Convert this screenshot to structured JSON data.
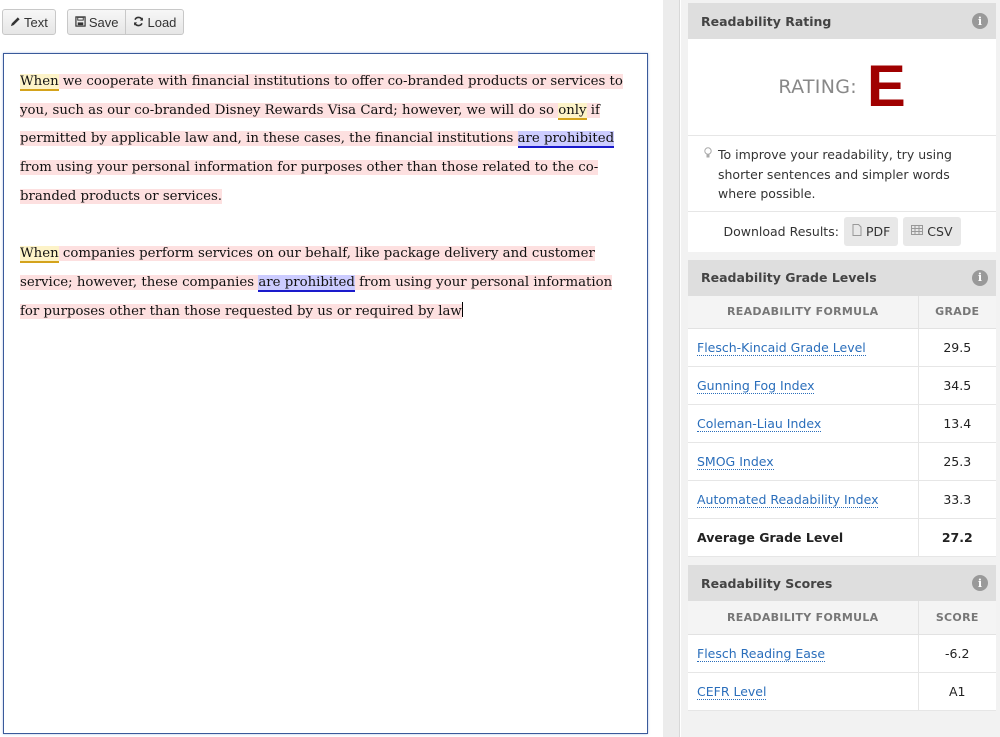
{
  "toolbar": {
    "text_label": "Text",
    "save_label": "Save",
    "load_label": "Load",
    "icons": {
      "text": "pencil-icon",
      "save": "floppy-disk-icon",
      "load": "refresh-icon"
    }
  },
  "editor": {
    "paragraphs": [
      {
        "segments": [
          {
            "text": "When",
            "type": "adverb"
          },
          {
            "text": " we cooperate with financial institutions to offer co-branded products or services to you, such as our co-branded Disney Rewards Visa Card; however, we will do so ",
            "type": "long"
          },
          {
            "text": "only",
            "type": "adverb"
          },
          {
            "text": " if permitted by applicable law and, in these cases, the financial institutions ",
            "type": "long"
          },
          {
            "text": "are prohibited",
            "type": "passive"
          },
          {
            "text": " from using your personal information for purposes other than those related to the co-branded products or services.",
            "type": "long"
          }
        ]
      },
      {
        "segments": [
          {
            "text": "When",
            "type": "adverb"
          },
          {
            "text": " companies perform services on our behalf, like package delivery and customer service; however, these companies ",
            "type": "long"
          },
          {
            "text": "are prohibited",
            "type": "passive"
          },
          {
            "text": " from using your personal information for purposes other than those requested by us or required by law",
            "type": "long"
          }
        ]
      }
    ],
    "highlight_colors": {
      "long_sentence": "#fde0e0",
      "adverb": "#fdf3c8",
      "passive_voice": "#ccccff"
    }
  },
  "rating_panel": {
    "title": "Readability Rating",
    "rating_label": "RATING:",
    "rating_grade": "E",
    "rating_color": "#a00000",
    "tip": "To improve your readability, try using shorter sentences and simpler words where possible.",
    "download_label": "Download Results:",
    "pdf_label": "PDF",
    "csv_label": "CSV"
  },
  "grade_panel": {
    "title": "Readability Grade Levels",
    "col_formula": "READABILITY FORMULA",
    "col_value": "GRADE",
    "rows": [
      {
        "name": "Flesch-Kincaid Grade Level",
        "value": "29.5"
      },
      {
        "name": "Gunning Fog Index",
        "value": "34.5"
      },
      {
        "name": "Coleman-Liau Index",
        "value": "13.4"
      },
      {
        "name": "SMOG Index",
        "value": "25.3"
      },
      {
        "name": "Automated Readability Index",
        "value": "33.3"
      }
    ],
    "average": {
      "name": "Average Grade Level",
      "value": "27.2"
    }
  },
  "scores_panel": {
    "title": "Readability Scores",
    "col_formula": "READABILITY FORMULA",
    "col_value": "SCORE",
    "rows": [
      {
        "name": "Flesch Reading Ease",
        "value": "-6.2"
      },
      {
        "name": "CEFR Level",
        "value": "A1"
      }
    ]
  }
}
